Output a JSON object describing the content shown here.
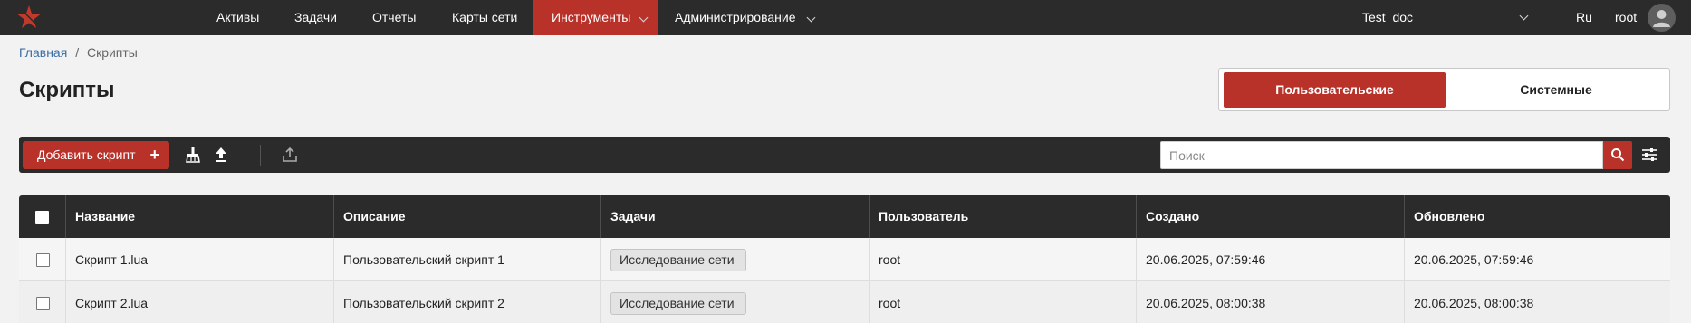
{
  "topbar": {
    "nav": [
      "Активы",
      "Задачи",
      "Отчеты",
      "Карты сети",
      "Инструменты",
      "Администрирование"
    ],
    "active_nav": "Инструменты",
    "project": "Test_doc",
    "language": "Ru",
    "user": "root",
    "accent_color": "#b8322a",
    "bar_color": "#2b2b2b"
  },
  "breadcrumb": {
    "home": "Главная",
    "separator": "/",
    "current": "Скрипты"
  },
  "page": {
    "title": "Скрипты"
  },
  "tabs": {
    "user": "Пользовательские",
    "system": "Системные",
    "active": "Пользовательские"
  },
  "toolbar": {
    "add_label": "Добавить скрипт",
    "add_icon": "+",
    "icons": [
      "clean-icon",
      "upload-icon",
      "export-icon"
    ],
    "search_placeholder": "Поиск",
    "search_icon": "search-icon",
    "filter_icon": "filter-settings-icon"
  },
  "table": {
    "columns": [
      "Название",
      "Описание",
      "Задачи",
      "Пользователь",
      "Создано",
      "Обновлено"
    ],
    "rows": [
      {
        "name": "Скрипт 1.lua",
        "description": "Пользовательский скрипт 1",
        "task": "Исследование сети",
        "user": "root",
        "created": "20.06.2025, 07:59:46",
        "updated": "20.06.2025, 07:59:46"
      },
      {
        "name": "Скрипт 2.lua",
        "description": "Пользовательский скрипт 2",
        "task": "Исследование сети",
        "user": "root",
        "created": "20.06.2025, 08:00:38",
        "updated": "20.06.2025, 08:00:38"
      }
    ]
  }
}
